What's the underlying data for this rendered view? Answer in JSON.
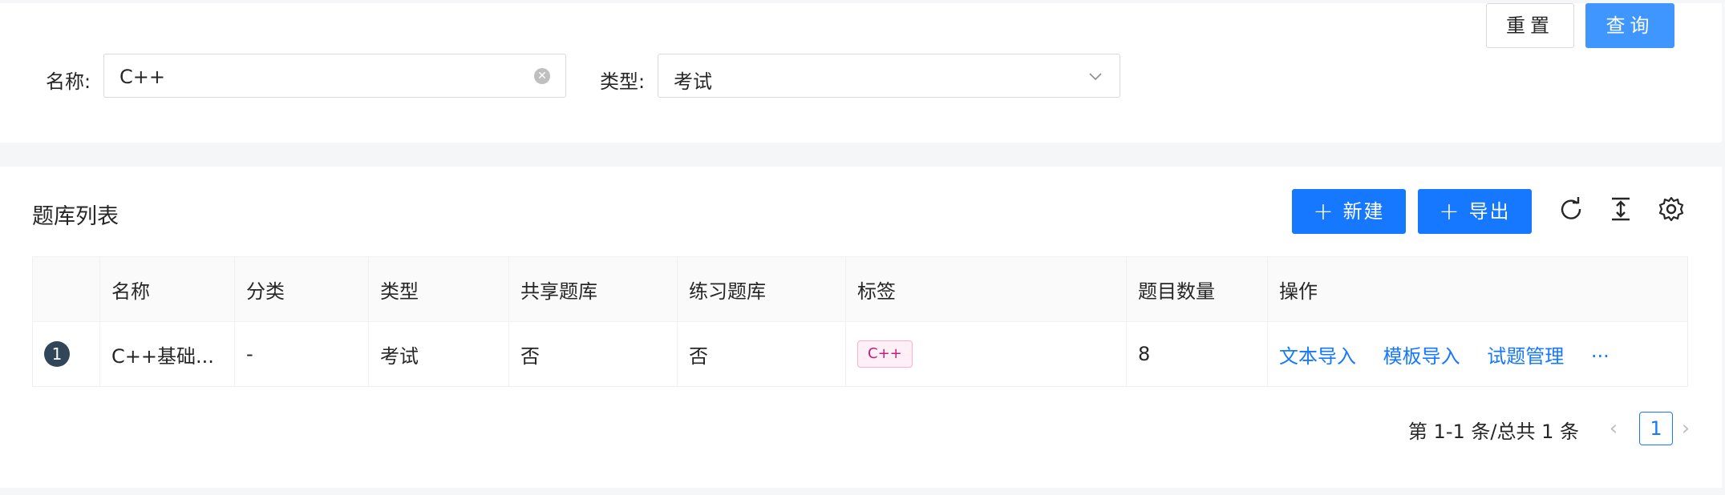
{
  "search": {
    "name_label": "名称:",
    "name_value": "C++",
    "type_label": "类型:",
    "type_value": "考试",
    "reset_label": "重置",
    "query_label": "查询"
  },
  "table": {
    "title": "题库列表",
    "new_label": "新建",
    "export_label": "导出",
    "columns": [
      "名称",
      "分类",
      "类型",
      "共享题库",
      "练习题库",
      "标签",
      "题目数量",
      "操作"
    ],
    "rows": [
      {
        "index": "1",
        "name": "C++基础...",
        "category": "-",
        "type": "考试",
        "shared": "否",
        "practice": "否",
        "tag": "C++",
        "count": "8",
        "actions": [
          "文本导入",
          "模板导入",
          "试题管理",
          "···"
        ]
      }
    ]
  },
  "pagination": {
    "summary": "第 1-1 条/总共 1 条",
    "current": "1"
  },
  "icons": {
    "clear": "clear-circle-icon",
    "dropdown": "chevron-down-icon",
    "refresh": "refresh-icon",
    "density": "column-height-icon",
    "settings": "gear-icon"
  },
  "colors": {
    "primary": "#1677ff",
    "query_button": "#4096ff",
    "index_badge": "#314659",
    "tag_text": "#c41d7f"
  }
}
